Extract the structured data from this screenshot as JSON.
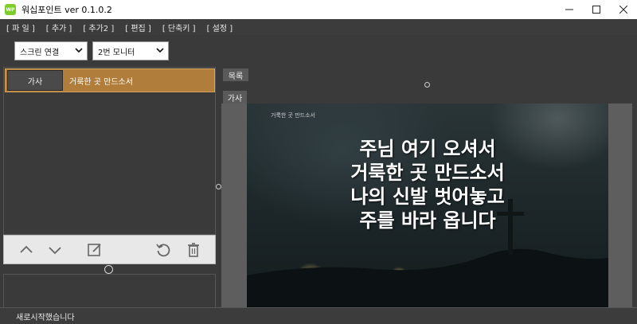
{
  "window": {
    "logo_text": "WP",
    "title": "워십포인트 ver 0.1.0.2"
  },
  "menu": {
    "items": [
      "[ 파 일 ]",
      "[ 추가 ]",
      "[ 추가2 ]",
      "[ 편집 ]",
      "[ 단축키 ]",
      "[ 설정 ]"
    ]
  },
  "toolbar": {
    "screen_select": "스크린 연결",
    "monitor_select": "2번 모니터"
  },
  "list": {
    "items": [
      {
        "tag": "가사",
        "title": "거룩한 곳 만드소서"
      }
    ]
  },
  "right": {
    "tab_list": "목록",
    "tab_lyrics": "가사"
  },
  "preview": {
    "caption": "거룩한 곳 만드소서",
    "lyrics": [
      "주님 여기 오셔서",
      "거룩한 곳 만드소서",
      "나의 신발 벗어놓고",
      "주를 바라 옵니다"
    ]
  },
  "status": {
    "text": "새로시작했습니다"
  },
  "colors": {
    "selected_row": "#b07d3a",
    "panel_bg": "#3a3a3a",
    "toolbar_bg": "#e8e8e8"
  }
}
